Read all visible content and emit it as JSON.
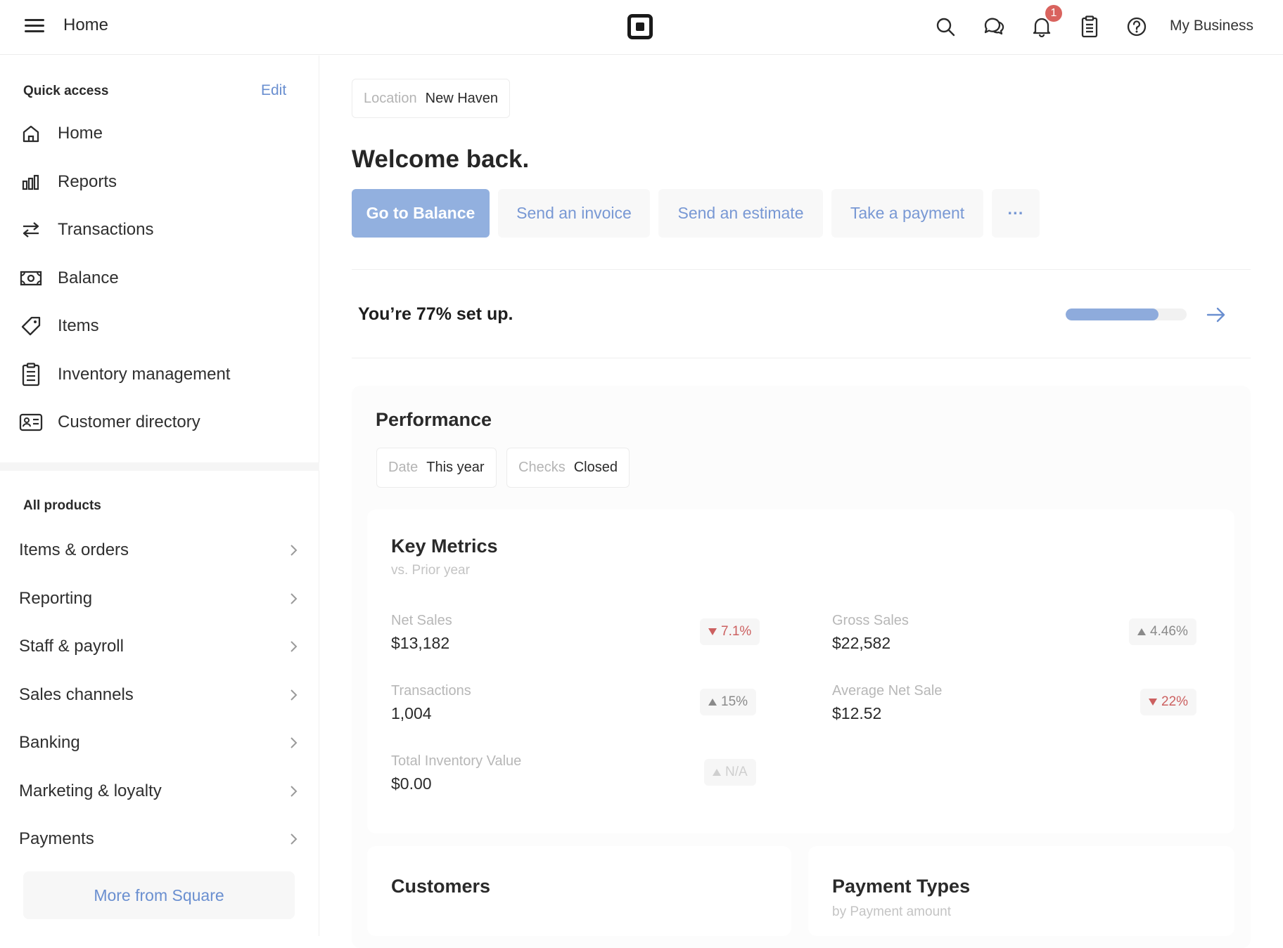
{
  "topbar": {
    "title": "Home",
    "notification_count": "1",
    "business_name": "My Business"
  },
  "sidebar": {
    "quick_access": {
      "heading": "Quick access",
      "edit_label": "Edit",
      "items": [
        {
          "label": "Home",
          "icon": "home-icon"
        },
        {
          "label": "Reports",
          "icon": "bar-chart-icon"
        },
        {
          "label": "Transactions",
          "icon": "swap-arrows-icon"
        },
        {
          "label": "Balance",
          "icon": "cash-icon"
        },
        {
          "label": "Items",
          "icon": "tag-icon"
        },
        {
          "label": "Inventory management",
          "icon": "clipboard-icon"
        },
        {
          "label": "Customer directory",
          "icon": "id-card-icon"
        }
      ]
    },
    "all_products": {
      "heading": "All products",
      "items": [
        {
          "label": "Items & orders"
        },
        {
          "label": "Reporting"
        },
        {
          "label": "Staff & payroll"
        },
        {
          "label": "Sales channels"
        },
        {
          "label": "Banking"
        },
        {
          "label": "Marketing & loyalty"
        },
        {
          "label": "Payments"
        }
      ]
    },
    "more_label": "More from Square"
  },
  "main": {
    "location": {
      "key": "Location",
      "value": "New Haven"
    },
    "welcome": "Welcome back.",
    "actions": [
      {
        "label": "Go to Balance",
        "style": "primary"
      },
      {
        "label": "Send an invoice",
        "style": "secondary"
      },
      {
        "label": "Send an estimate",
        "style": "secondary"
      },
      {
        "label": "Take a payment",
        "style": "secondary"
      },
      {
        "label": "···",
        "style": "secondary"
      }
    ],
    "setup": {
      "text": "You’re 77% set up.",
      "progress": 0.77
    },
    "performance": {
      "title": "Performance",
      "filters": [
        {
          "key": "Date",
          "value": "This year"
        },
        {
          "key": "Checks",
          "value": "Closed"
        }
      ],
      "key_metrics": {
        "title": "Key Metrics",
        "subtitle": "vs. Prior year",
        "metrics": [
          {
            "label": "Net Sales",
            "value": "$13,182",
            "change": "7.1%",
            "direction": "down"
          },
          {
            "label": "Gross Sales",
            "value": "$22,582",
            "change": "4.46%",
            "direction": "up"
          },
          {
            "label": "Transactions",
            "value": "1,004",
            "change": "15%",
            "direction": "up"
          },
          {
            "label": "Average Net Sale",
            "value": "$12.52",
            "change": "22%",
            "direction": "down"
          },
          {
            "label": "Total Inventory Value",
            "value": "$0.00",
            "change": "N/A",
            "direction": "na"
          }
        ]
      },
      "customers": {
        "title": "Customers"
      },
      "payment_types": {
        "title": "Payment Types",
        "subtitle": "by Payment amount"
      }
    }
  },
  "colors": {
    "accent": "#92b0df",
    "link": "#6a8fd0",
    "negative": "#cc6060",
    "badge": "#d9635e"
  }
}
